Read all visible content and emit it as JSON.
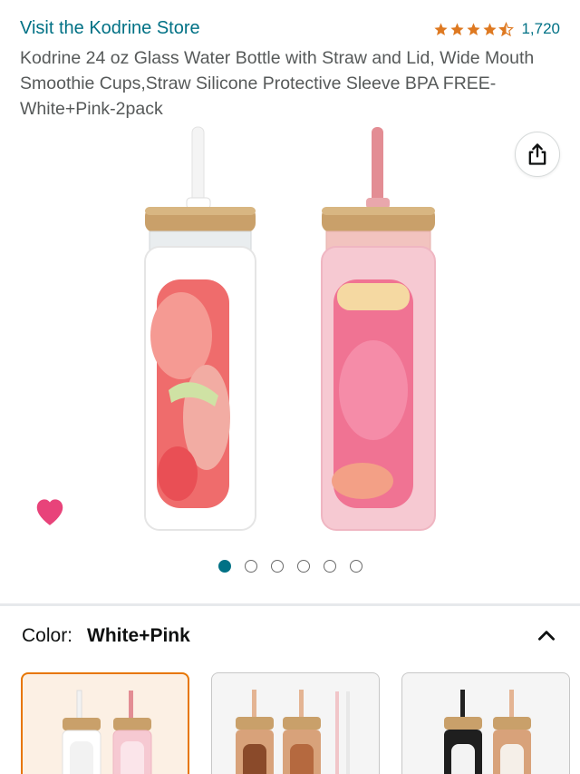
{
  "store": {
    "link_text": "Visit the Kodrine Store"
  },
  "rating": {
    "stars": 4.5,
    "count": "1,720"
  },
  "product": {
    "title": "Kodrine 24 oz Glass Water Bottle with Straw and Lid, Wide Mouth Smoothie Cups,Straw Silicone Protective Sleeve BPA FREE-White+Pink-2pack"
  },
  "gallery": {
    "image_count": 6,
    "active_index": 0
  },
  "icons": {
    "share": "share-icon",
    "wishlist": "heart-icon",
    "collapse": "chevron-up-icon"
  },
  "variation": {
    "label": "Color:",
    "selected": "White+Pink",
    "swatches": [
      "White+Pink",
      "Brown",
      "Black+Brown"
    ]
  },
  "colors": {
    "link": "#007185",
    "star": "#de7921",
    "heart": "#e8437a",
    "selected_border": "#e77600",
    "active_dot": "#007185"
  }
}
